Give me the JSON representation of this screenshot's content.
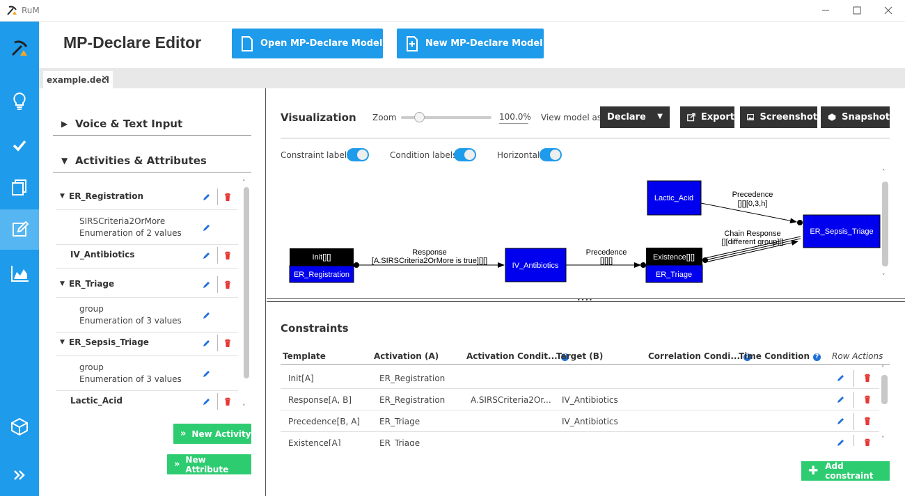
{
  "window": {
    "title": "RuM"
  },
  "header": {
    "title": "MP-Declare Editor",
    "open_button": "Open MP-Declare Model",
    "new_button": "New MP-Declare Model"
  },
  "tabs": [
    {
      "label": "example.decl",
      "close": "✕"
    }
  ],
  "sidebar": {
    "items": [
      {
        "icon": "pickaxe-logo-icon"
      },
      {
        "icon": "lightbulb-icon"
      },
      {
        "icon": "checkmark-icon"
      },
      {
        "icon": "layers-icon"
      },
      {
        "icon": "edit-icon",
        "active": true
      },
      {
        "icon": "area-chart-icon"
      },
      {
        "icon": "cube-icon"
      },
      {
        "icon": "double-chevron-right-icon"
      }
    ]
  },
  "left_panel": {
    "voice_section": "Voice & Text Input",
    "activities_section": "Activities & Attributes",
    "items": [
      {
        "type": "activity",
        "name": "ER_Registration",
        "expanded": true
      },
      {
        "type": "attribute",
        "name": "SIRSCriteria2OrMore",
        "desc": "Enumeration of 2 values"
      },
      {
        "type": "activity",
        "name": "IV_Antibiotics",
        "expanded": false
      },
      {
        "type": "activity",
        "name": "ER_Triage",
        "expanded": true
      },
      {
        "type": "attribute",
        "name": "group",
        "desc": "Enumeration of 3 values"
      },
      {
        "type": "activity",
        "name": "ER_Sepsis_Triage",
        "expanded": true
      },
      {
        "type": "attribute",
        "name": "group",
        "desc": "Enumeration of 3 values"
      },
      {
        "type": "activity",
        "name": "Lactic_Acid",
        "expanded": false
      }
    ],
    "new_activity_button": "New Activity",
    "new_attribute_button": "New Attribute"
  },
  "visualization": {
    "title": "Visualization",
    "zoom_label": "Zoom",
    "zoom_value": "100.0%",
    "zoom_fraction": 0.2,
    "view_as_label": "View model as:",
    "view_as_value": "Declare",
    "export_button": "Export",
    "screenshot_button": "Screenshot",
    "snapshot_button": "Snapshot",
    "toggles": {
      "constraint_labels": "Constraint labels",
      "condition_labels": "Condition labels",
      "horizontal": "Horizontal"
    },
    "graph": {
      "nodes": {
        "er_registration_top": "Init[][]",
        "er_registration": "ER_Registration",
        "iv_antibiotics": "IV_Antibiotics",
        "er_triage_top": "Existence[][]",
        "er_triage": "ER_Triage",
        "lactic_acid": "Lactic_Acid",
        "er_sepsis_triage": "ER_Sepsis_Triage"
      },
      "edges": {
        "response_name": "Response",
        "response_cond": "[A.SIRSCriteria2OrMore is true][][]",
        "precedence1_name": "Precedence",
        "precedence1_cond": "[][][]",
        "precedence2_name": "Precedence",
        "precedence2_cond": "[][][0,3,h]",
        "chain_name": "Chain Response",
        "chain_cond": "[][different group][]"
      },
      "colors": {
        "node_fill": "#0000ee",
        "node_top": "#000000"
      }
    }
  },
  "constraints": {
    "title": "Constraints",
    "columns": [
      "Template",
      "Activation (A)",
      "Activation Condit...",
      "Target (B)",
      "Correlation Condi...",
      "Time Condition",
      "Row Actions"
    ],
    "rows": [
      [
        "Init[A]",
        "ER_Registration",
        "",
        ""
      ],
      [
        "Response[A, B]",
        "ER_Registration",
        "A.SIRSCriteria2Or...",
        "IV_Antibiotics"
      ],
      [
        "Precedence[B, A]",
        "ER_Triage",
        "",
        "IV_Antibiotics"
      ],
      [
        "Existence[A]",
        "ER_Triage",
        "",
        ""
      ]
    ],
    "add_button": "Add constraint"
  },
  "colors": {
    "sidebar": "#1e9bea",
    "primary": "#1e9bea",
    "success": "#2ecc71",
    "dark": "#333333",
    "danger": "#e53935"
  }
}
